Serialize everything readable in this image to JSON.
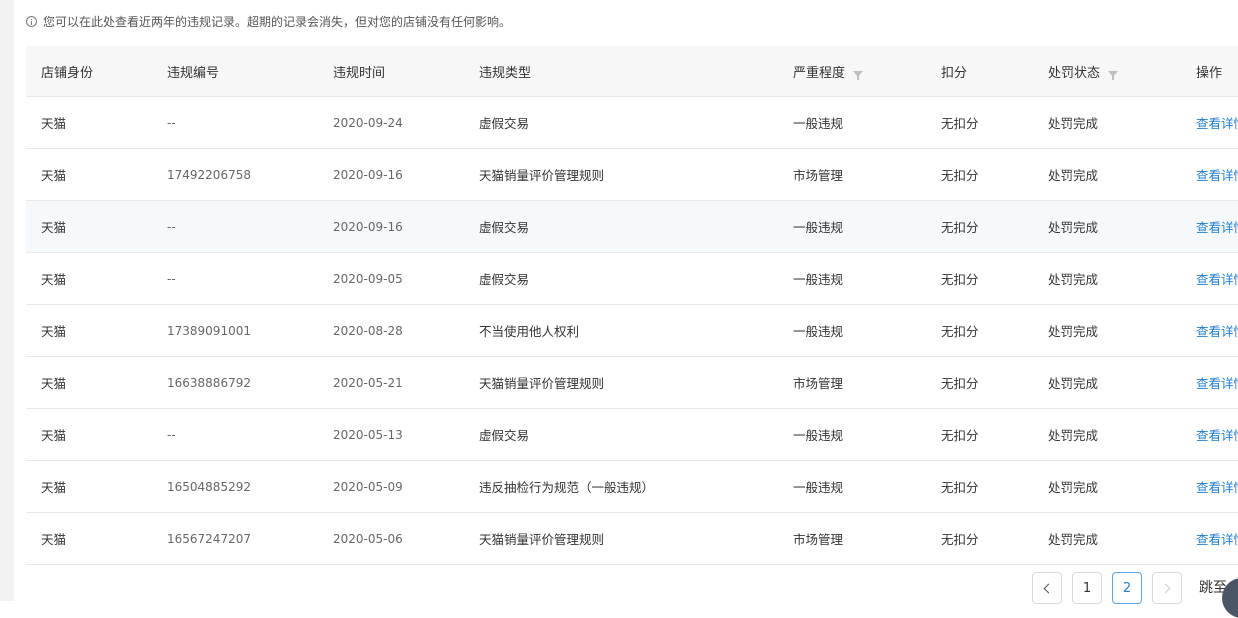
{
  "notice": {
    "icon": "info-icon",
    "text": "您可以在此处查看近两年的违规记录。超期的记录会消失，但对您的店铺没有任何影响。"
  },
  "table": {
    "columns": [
      "店铺身份",
      "违规编号",
      "违规时间",
      "违规类型",
      "严重程度",
      "扣分",
      "处罚状态",
      "操作"
    ],
    "rows": [
      {
        "identity": "天猫",
        "code": "--",
        "date": "2020-09-24",
        "type": "虚假交易",
        "severity": "一般违规",
        "points": "无扣分",
        "status": "处罚完成",
        "action": "查看详情"
      },
      {
        "identity": "天猫",
        "code": "17492206758",
        "date": "2020-09-16",
        "type": "天猫销量评价管理规则",
        "severity": "市场管理",
        "points": "无扣分",
        "status": "处罚完成",
        "action": "查看详情"
      },
      {
        "identity": "天猫",
        "code": "--",
        "date": "2020-09-16",
        "type": "虚假交易",
        "severity": "一般违规",
        "points": "无扣分",
        "status": "处罚完成",
        "action": "查看详情"
      },
      {
        "identity": "天猫",
        "code": "--",
        "date": "2020-09-05",
        "type": "虚假交易",
        "severity": "一般违规",
        "points": "无扣分",
        "status": "处罚完成",
        "action": "查看详情"
      },
      {
        "identity": "天猫",
        "code": "17389091001",
        "date": "2020-08-28",
        "type": "不当使用他人权利",
        "severity": "一般违规",
        "points": "无扣分",
        "status": "处罚完成",
        "action": "查看详情"
      },
      {
        "identity": "天猫",
        "code": "16638886792",
        "date": "2020-05-21",
        "type": "天猫销量评价管理规则",
        "severity": "市场管理",
        "points": "无扣分",
        "status": "处罚完成",
        "action": "查看详情"
      },
      {
        "identity": "天猫",
        "code": "--",
        "date": "2020-05-13",
        "type": "虚假交易",
        "severity": "一般违规",
        "points": "无扣分",
        "status": "处罚完成",
        "action": "查看详情"
      },
      {
        "identity": "天猫",
        "code": "16504885292",
        "date": "2020-05-09",
        "type": "违反抽检行为规范（一般违规）",
        "severity": "一般违规",
        "points": "无扣分",
        "status": "处罚完成",
        "action": "查看详情"
      },
      {
        "identity": "天猫",
        "code": "16567247207",
        "date": "2020-05-06",
        "type": "天猫销量评价管理规则",
        "severity": "市场管理",
        "points": "无扣分",
        "status": "处罚完成",
        "action": "查看详情"
      }
    ]
  },
  "pagination": {
    "pages": [
      "1",
      "2"
    ],
    "current": "2",
    "jump_label": "跳至"
  },
  "colors": {
    "link": "#1f7fd4",
    "header_bg": "#f7f7f7",
    "row_highlight": "#f5f9fc",
    "active_page_border": "#5aa6e3"
  }
}
